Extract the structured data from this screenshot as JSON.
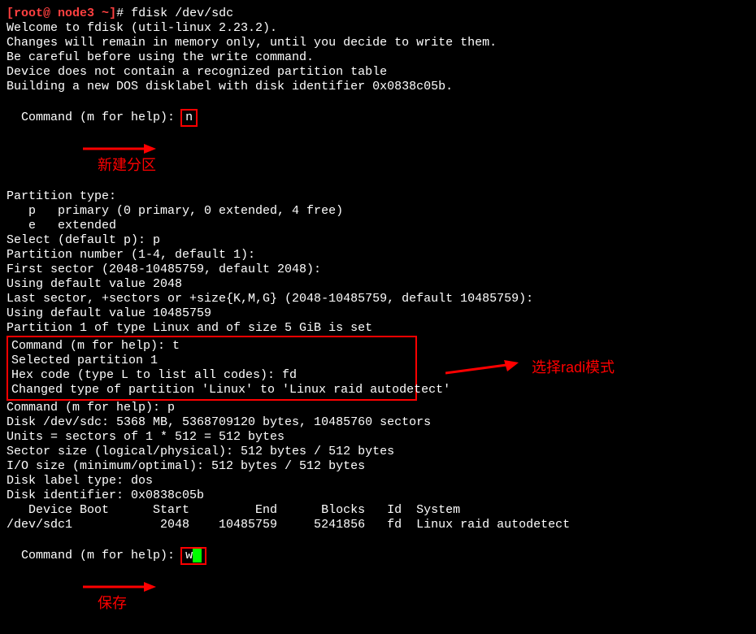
{
  "prompt": {
    "bracket_open": "[",
    "user_host": "root@ node3",
    "tilde": " ~",
    "bracket_close": "]",
    "hash": "# ",
    "command": "fdisk /dev/sdc"
  },
  "welcome": "Welcome to fdisk (util-linux 2.23.2).",
  "blank": "",
  "mem_line": "Changes will remain in memory only, until you decide to write them.",
  "careful": "Be careful before using the write command.",
  "nodevice": "Device does not contain a recognized partition table",
  "building": "Building a new DOS disklabel with disk identifier 0x0838c05b.",
  "cmd_prompt": "Command (m for help): ",
  "input_n": "n",
  "anno_new": "新建分区",
  "ptype": "Partition type:",
  "p_primary": "   p   primary (0 primary, 0 extended, 4 free)",
  "p_extended": "   e   extended",
  "select_default": "Select (default p): p",
  "partnum": "Partition number (1-4, default 1):",
  "firstsector": "First sector (2048-10485759, default 2048):",
  "default2048": "Using default value 2048",
  "lastsector": "Last sector, +sectors or +size{K,M,G} (2048-10485759, default 10485759):",
  "default_last": "Using default value 10485759",
  "set5g": "Partition 1 of type Linux and of size 5 GiB is set",
  "cmd_t": "Command (m for help): t",
  "selected1": "Selected partition 1",
  "hexcode": "Hex code (type L to list all codes): fd",
  "changed": "Changed type of partition 'Linux' to 'Linux raid autodetect'",
  "anno_raid": "选择radi模式",
  "cmd_p": "Command (m for help): p",
  "disk_info": "Disk /dev/sdc: 5368 MB, 5368709120 bytes, 10485760 sectors",
  "units": "Units = sectors of 1 * 512 = 512 bytes",
  "ssize": "Sector size (logical/physical): 512 bytes / 512 bytes",
  "iosize": "I/O size (minimum/optimal): 512 bytes / 512 bytes",
  "labeltype": "Disk label type: dos",
  "diskid": "Disk identifier: 0x0838c05b",
  "tbl_head": "   Device Boot      Start         End      Blocks   Id  System",
  "tbl_row": "/dev/sdc1            2048    10485759     5241856   fd  Linux raid autodetect",
  "input_w": "w",
  "anno_save": "保存"
}
